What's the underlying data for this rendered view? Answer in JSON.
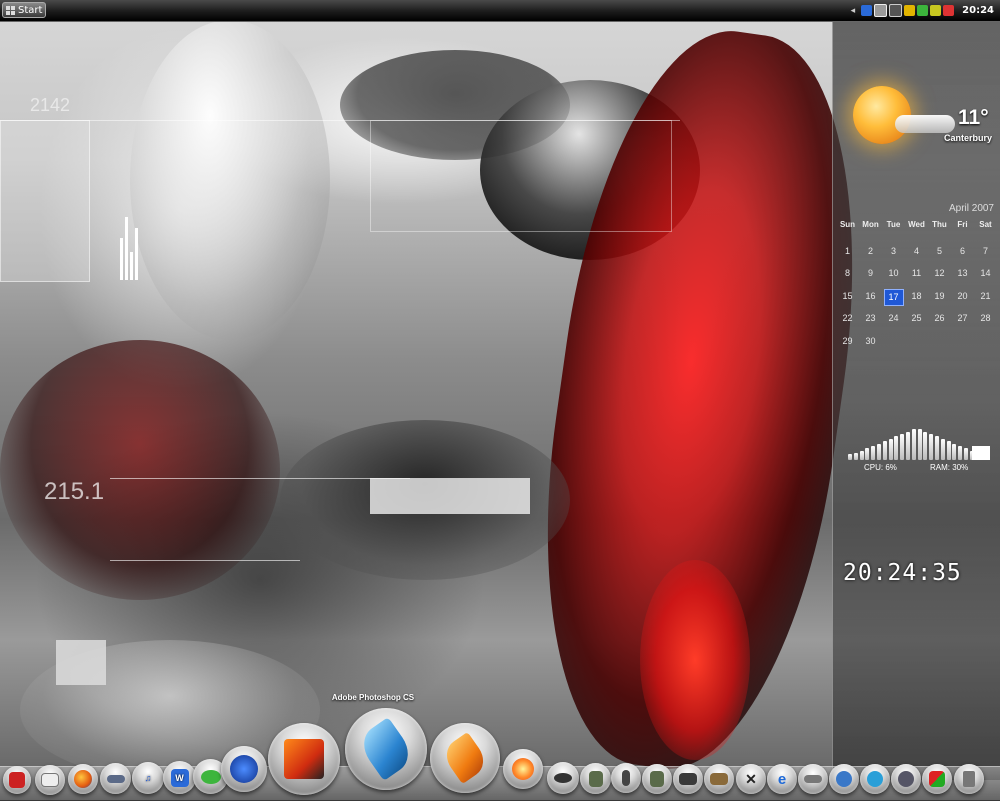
{
  "topbar": {
    "start_label": "Start",
    "tray_icons": [
      "windows-icon",
      "network-icon",
      "monitor-icon",
      "shield-icon",
      "battery-icon",
      "volume-icon",
      "display-icon"
    ],
    "tray_arrow": "◂",
    "clock": "20:24"
  },
  "weather": {
    "temp": "11°",
    "city": "Canterbury"
  },
  "calendar": {
    "title": "April 2007",
    "headers": [
      "Sun",
      "Mon",
      "Tue",
      "Wed",
      "Thu",
      "Fri",
      "Sat"
    ],
    "days": [
      "1",
      "2",
      "3",
      "4",
      "5",
      "6",
      "7",
      "8",
      "9",
      "10",
      "11",
      "12",
      "13",
      "14",
      "15",
      "16",
      "17",
      "18",
      "19",
      "20",
      "21",
      "22",
      "23",
      "24",
      "25",
      "26",
      "27",
      "28",
      "29",
      "30"
    ],
    "today": "17"
  },
  "meter": {
    "cpu_label": "CPU: 6%",
    "ram_label": "RAM: 30%"
  },
  "clock": {
    "time": "20:24:35"
  },
  "wallpaper": {
    "number_top": "2142",
    "number_mid": "215.1"
  },
  "dock": {
    "tooltip": "Adobe Photoshop CS"
  },
  "colors": {
    "accent_red": "#e21b1b",
    "calendar_today": "#1f58d6"
  }
}
